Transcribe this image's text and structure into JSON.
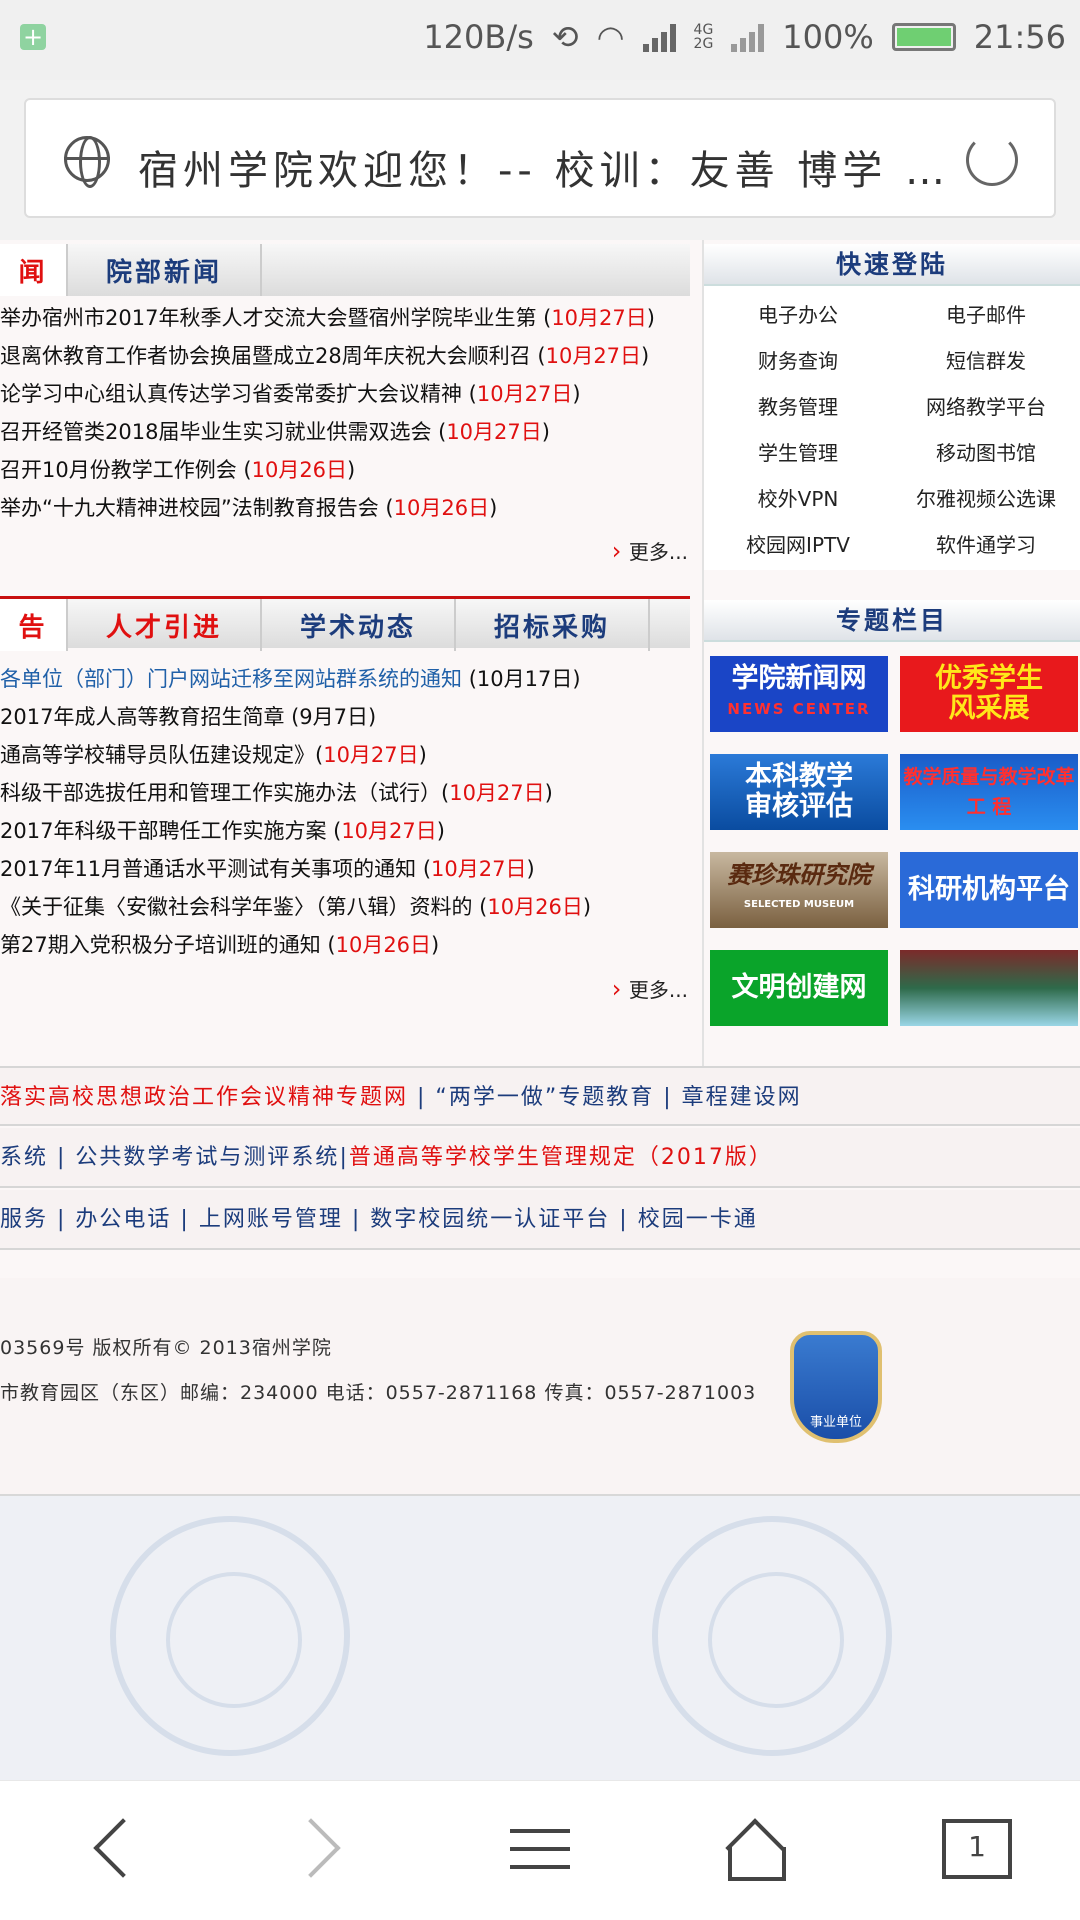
{
  "status": {
    "speed": "120B/s",
    "battery": "100%",
    "time": "21:56",
    "net1": "4G",
    "net2": "2G"
  },
  "url_bar": {
    "title": "宿州学院欢迎您！-- 校训：友善 博学 …"
  },
  "news1": {
    "tabs": [
      "闻",
      "院部新闻"
    ],
    "items": [
      {
        "text": "举办宿州市2017年秋季人才交流大会暨宿州学院毕业生第 (",
        "date": "10月27日",
        "end": ")"
      },
      {
        "text": "退离休教育工作者协会换届暨成立28周年庆祝大会顺利召 (",
        "date": "10月27日",
        "end": ")"
      },
      {
        "text": "论学习中心组认真传达学习省委常委扩大会议精神 (",
        "date": "10月27日",
        "end": ")"
      },
      {
        "text": "召开经管类2018届毕业生实习就业供需双选会 (",
        "date": "10月27日",
        "end": ")"
      },
      {
        "text": "召开10月份教学工作例会 (",
        "date": "10月26日",
        "end": ")"
      },
      {
        "text": "举办“十九大精神进校园”法制教育报告会 (",
        "date": "10月26日",
        "end": ")"
      }
    ],
    "more": "更多..."
  },
  "quick_login": {
    "title": "快速登陆",
    "links": [
      "电子办公",
      "电子邮件",
      "财务查询",
      "短信群发",
      "教务管理",
      "网络教学平台",
      "学生管理",
      "移动图书馆",
      "校外VPN",
      "尔雅视频公选课",
      "校园网IPTV",
      "软件通学习"
    ]
  },
  "news2": {
    "tabs": [
      "告",
      "人才引进",
      "学术动态",
      "招标采购"
    ],
    "items": [
      {
        "text": "各单位（部门）门户网站迁移至网站群系统的通知",
        "date": "(10月17日)",
        "blue": true
      },
      {
        "text": "2017年成人高等教育招生简章 (9月7日)",
        "date": ""
      },
      {
        "text": "通高等学校辅导员队伍建设规定》(",
        "date": "10月27日",
        "end": ")"
      },
      {
        "text": "科级干部选拔任用和管理工作实施办法（试行）(",
        "date": "10月27日",
        "end": ")"
      },
      {
        "text": "2017年科级干部聘任工作实施方案 (",
        "date": "10月27日",
        "end": ")"
      },
      {
        "text": "2017年11月普通话水平测试有关事项的通知 (",
        "date": "10月27日",
        "end": ")"
      },
      {
        "text": "《关于征集〈安徽社会科学年鉴〉（第八辑）资料的 (",
        "date": "10月26日",
        "end": ")"
      },
      {
        "text": "第27期入党积极分子培训班的通知 (",
        "date": "10月26日",
        "end": ")"
      }
    ],
    "more": "更多..."
  },
  "special": {
    "title": "专题栏目",
    "banners": [
      {
        "line1": "学院新闻网",
        "line2": "NEWS CENTER"
      },
      {
        "line1": "优秀学生",
        "line2": "风采展"
      },
      {
        "line1": "本科教学",
        "line2": "审核评估"
      },
      {
        "line1": "教学质量与教学改革",
        "line2": "工 程"
      },
      {
        "line1": "赛珍珠研究院",
        "line2": "SELECTED MUSEUM"
      },
      {
        "line1": "科研机构平台",
        "line2": ""
      },
      {
        "line1": "文明创建网",
        "line2": ""
      },
      {
        "line1": "",
        "line2": ""
      }
    ]
  },
  "bands": {
    "row1": {
      "a": "落实高校思想政治工作会议精神专题网",
      "sep1": " | ",
      "b": "“两学一做”专题教育",
      "sep2": " | ",
      "c": "章程建设网"
    },
    "row2": {
      "a": "系统",
      "sep1": " | ",
      "b": "公共数学考试与测评系统",
      "sep2": "|",
      "c": "普通高等学校学生管理规定（2017版）"
    },
    "row3": {
      "a": "服务",
      "b": "办公电话",
      "c": "上网账号管理",
      "d": "数字校园统一认证平台",
      "e": "校园一卡通",
      "sep": " | "
    }
  },
  "footer": {
    "line1": "03569号 版权所有© 2013宿州学院",
    "line2": "市教育园区（东区）邮编：234000 电话：0557-2871168 传真：0557-2871003",
    "seal": "事业单位"
  },
  "nav": {
    "tabs_count": "1"
  }
}
